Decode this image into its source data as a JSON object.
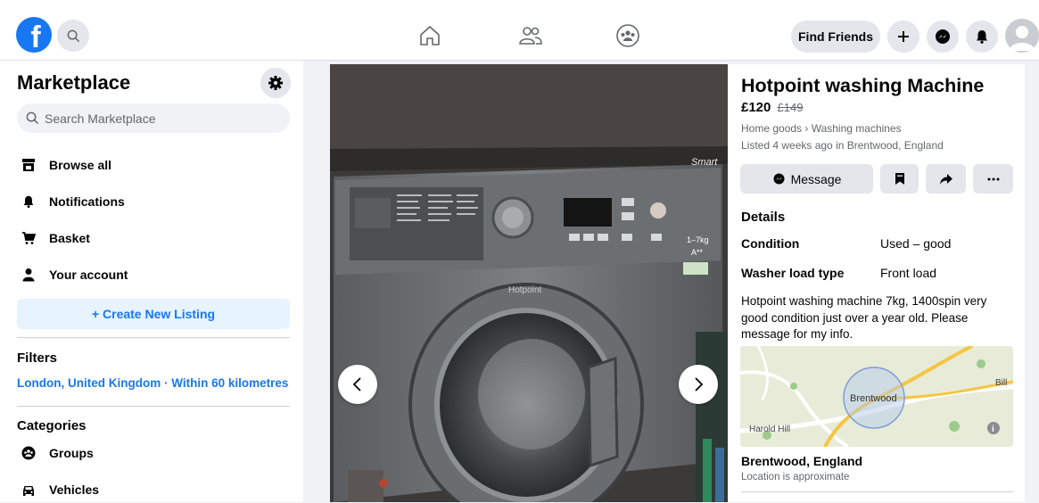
{
  "topbar": {
    "logo_letter": "f",
    "find_friends_label": "Find Friends"
  },
  "sidebar": {
    "title": "Marketplace",
    "search_placeholder": "Search Marketplace",
    "items": [
      {
        "label": "Browse all",
        "icon": "storefront-icon"
      },
      {
        "label": "Notifications",
        "icon": "bell-icon"
      },
      {
        "label": "Basket",
        "icon": "cart-icon"
      },
      {
        "label": "Your account",
        "icon": "person-icon"
      }
    ],
    "create_label": "+ Create New Listing",
    "filters_heading": "Filters",
    "filters_location": "London, United Kingdom · Within 60 kilometres",
    "categories_heading": "Categories",
    "categories": [
      {
        "label": "Groups",
        "icon": "groups-icon"
      },
      {
        "label": "Vehicles",
        "icon": "car-icon"
      }
    ]
  },
  "photo": {
    "panel_text": "Smart",
    "brand": "Hotpoint",
    "capacity": "1–7kg",
    "energy": "A**"
  },
  "listing": {
    "title": "Hotpoint washing Machine",
    "price": "£120",
    "old_price": "£149",
    "category_path": "Home goods › Washing machines",
    "listed": "Listed 4 weeks ago in Brentwood, England",
    "message_label": "Message",
    "details_heading": "Details",
    "condition_label": "Condition",
    "condition_value": "Used – good",
    "load_label": "Washer load type",
    "load_value": "Front load",
    "description": "Hotpoint washing machine 7kg, 1400spin very good condition just over a year old. Please message for my info.",
    "map": {
      "town": "Brentwood",
      "harold_hill": "Harold Hill",
      "bill": "Bill"
    },
    "location": "Brentwood, England",
    "location_note": "Location is approximate"
  },
  "colors": {
    "accent": "#1877f2",
    "light_accent": "#e7f3ff",
    "button_grey": "#e4e6eb"
  }
}
